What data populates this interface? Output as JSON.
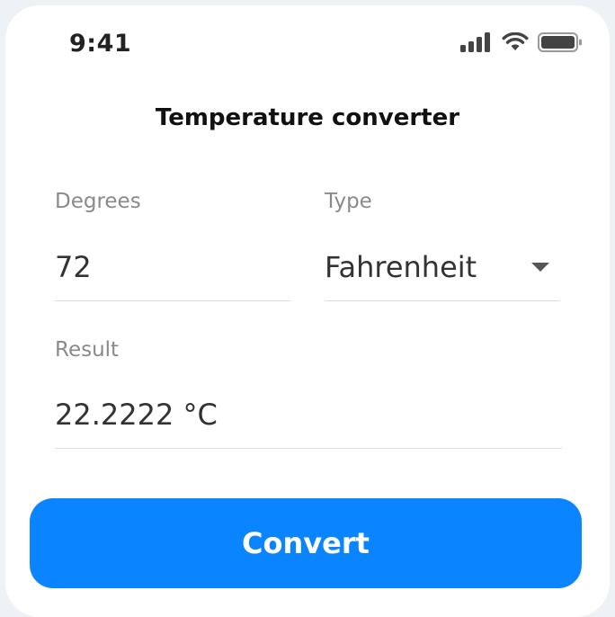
{
  "status_bar": {
    "time": "9:41",
    "icons": [
      "signal-icon",
      "wifi-icon",
      "battery-icon"
    ]
  },
  "header": {
    "title": "Temperature converter"
  },
  "form": {
    "degrees": {
      "label": "Degrees",
      "value": "72"
    },
    "type": {
      "label": "Type",
      "selected": "Fahrenheit"
    },
    "result": {
      "label": "Result",
      "value": "22.2222 °C"
    }
  },
  "actions": {
    "convert_label": "Convert"
  },
  "colors": {
    "accent": "#0a84ff",
    "label": "#8a8a8a",
    "divider": "#dcdcdc"
  }
}
